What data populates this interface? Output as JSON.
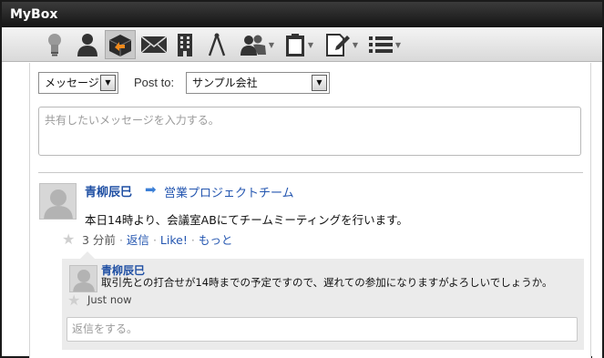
{
  "app": {
    "title": "MyBox"
  },
  "toolbar": {
    "icons": [
      "lightbulb-icon",
      "person-icon",
      "box-icon",
      "mail-icon",
      "building-icon",
      "compass-icon",
      "group-icon",
      "clipboard-icon",
      "edit-icon",
      "list-icon"
    ]
  },
  "composer": {
    "type_select": "メッセージ",
    "post_to_label": "Post to:",
    "post_to_select": "サンプル会社",
    "message_placeholder": "共有したいメッセージを入力する。"
  },
  "post": {
    "author": "青柳辰巳",
    "arrow": "➡",
    "target": "営業プロジェクトチーム",
    "message": "本日14時より、会議室ABにてチームミーティングを行います。",
    "time": "3 分前",
    "reply_link": "返信",
    "like_link": "Like!",
    "more_link": "もっと",
    "separator": "·"
  },
  "comment": {
    "author": "青柳辰巳",
    "message": "取引先との打合せが14時までの予定ですので、遅れての参加になりますがよろしいでしょうか。",
    "time": "Just now"
  },
  "reply_box": {
    "placeholder": "返信をする。"
  },
  "colors": {
    "accent": "#2456b0",
    "titlebar": "#1f1f1f",
    "toolbar": "#e4e4e4"
  }
}
